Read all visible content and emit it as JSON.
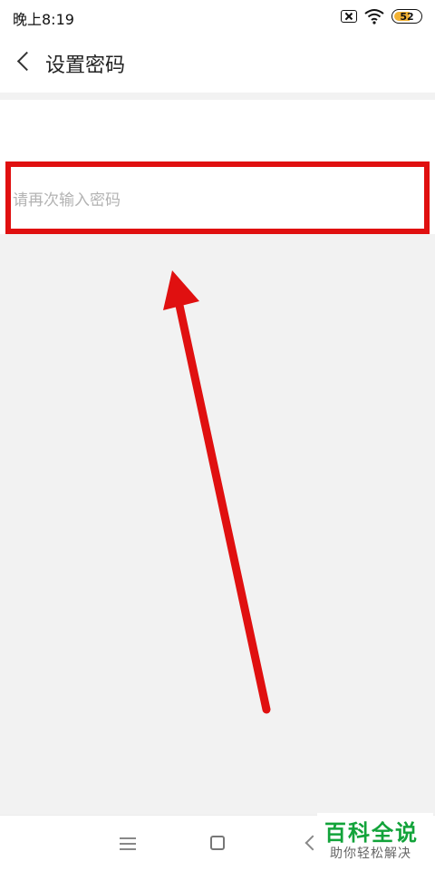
{
  "status_bar": {
    "time": "晚上8:19",
    "battery_level": "52",
    "icons": [
      "sim-off-icon",
      "wifi-icon",
      "battery-icon"
    ]
  },
  "header": {
    "title": "设置密码",
    "back_icon": "chevron-left-icon"
  },
  "form": {
    "confirm_password_placeholder": "请再次输入密码",
    "confirm_password_value": ""
  },
  "annotation": {
    "highlight_color": "#e01010",
    "arrow_color": "#e01010"
  },
  "nav_bar": {
    "icons": [
      "menu-icon",
      "home-icon",
      "back-icon"
    ]
  },
  "watermark": {
    "title": "百科全说",
    "subtitle": "助你轻松解决",
    "color": "#12a33a"
  }
}
